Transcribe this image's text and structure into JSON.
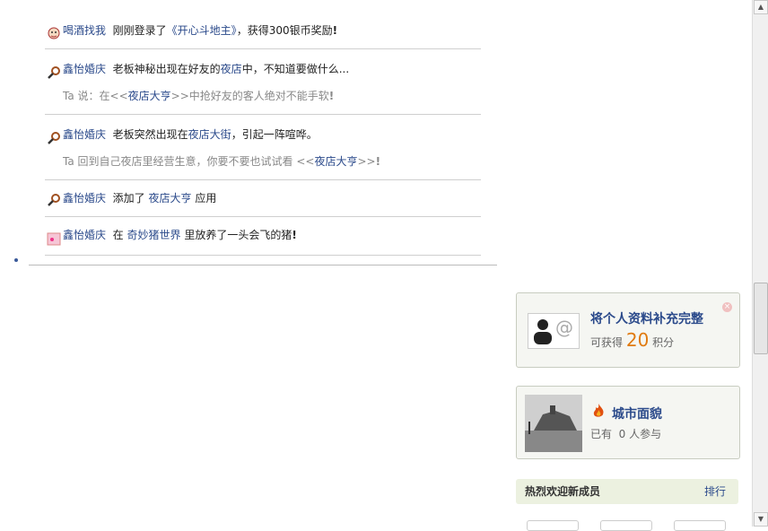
{
  "feed": [
    {
      "user": "喝酒找我",
      "a": "刚刚登录了",
      "b": "《开心斗地主》",
      "c": "，获得300银币奖励",
      "mark": "!"
    },
    {
      "user": "鑫怡婚庆",
      "a": "老板神秘出现在好友的",
      "b": "夜店",
      "c": "中，不知道要做什么...",
      "sub_pre": "Ta 说：在<<",
      "sub_link": "夜店大亨",
      "sub_post": ">>中抢好友的客人绝对不能手软",
      "mark": "!"
    },
    {
      "user": "鑫怡婚庆",
      "a": "老板突然出现在",
      "b": "夜店大街",
      "c": "，引起一阵喧哗。",
      "sub_pre": "Ta 回到自己夜店里经营生意，你要不要也试试看  <<",
      "sub_link": "夜店大亨",
      "sub_post": ">>",
      "mark": "!"
    },
    {
      "user": "鑫怡婚庆",
      "a": "添加了",
      "b": "夜店大亨",
      "c": "应用"
    },
    {
      "user": "鑫怡婚庆",
      "a": "在",
      "b": "奇妙猪世界",
      "c": "里放养了一头会飞的猪",
      "mark": "!"
    }
  ],
  "profile_card": {
    "title": "将个人资料补充完整",
    "prefix": "可获得",
    "points": "20",
    "suffix": "积分"
  },
  "city_card": {
    "title": "城市面貌",
    "pre": "已有",
    "count": "0",
    "post": "人参与"
  },
  "welcome": {
    "title": "热烈欢迎新成员",
    "rank": "排行"
  }
}
